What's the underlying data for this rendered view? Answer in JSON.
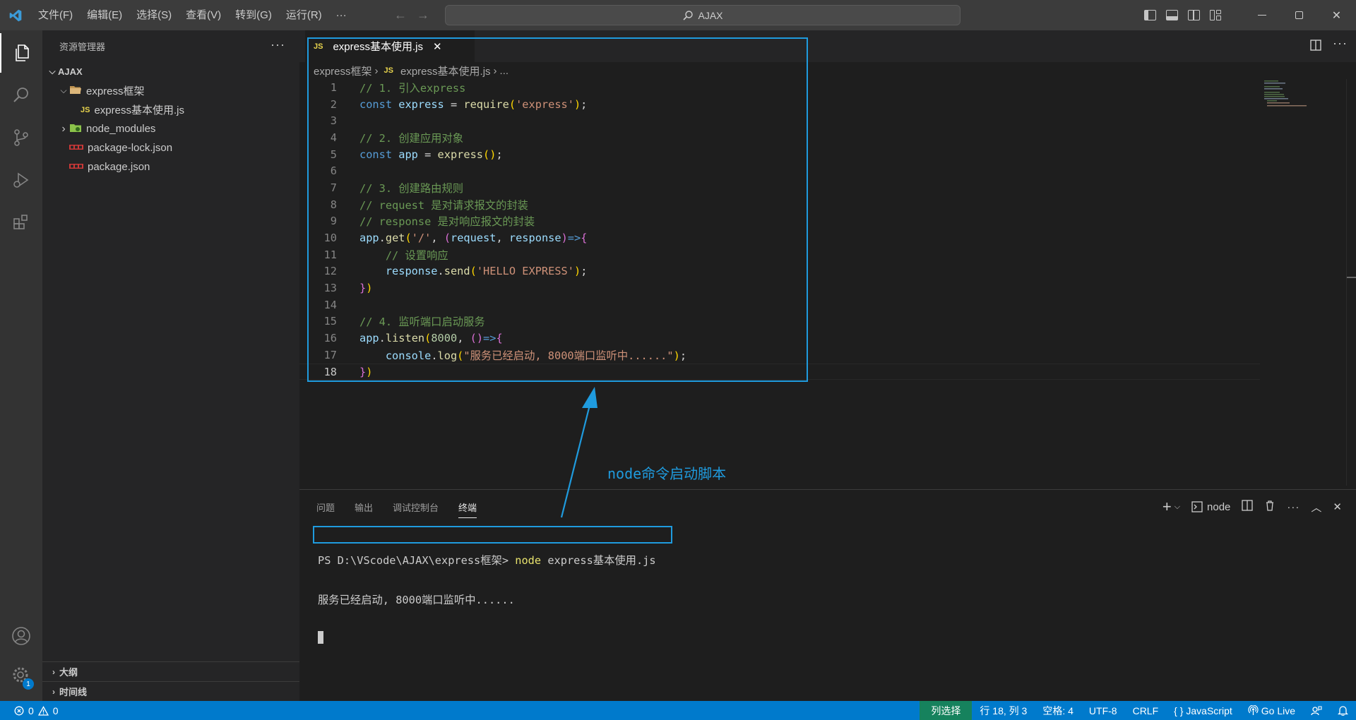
{
  "titlebar": {
    "menu": [
      "文件(F)",
      "编辑(E)",
      "选择(S)",
      "查看(V)",
      "转到(G)",
      "运行(R)",
      "···"
    ],
    "search": "AJAX"
  },
  "sidebar": {
    "title": "资源管理器",
    "root": "AJAX",
    "tree": [
      {
        "label": "express框架",
        "type": "folder-open",
        "depth": 1
      },
      {
        "label": "express基本使用.js",
        "type": "js",
        "depth": 2
      },
      {
        "label": "node_modules",
        "type": "folder-closed",
        "depth": 1
      },
      {
        "label": "package-lock.json",
        "type": "json",
        "depth": 1
      },
      {
        "label": "package.json",
        "type": "json",
        "depth": 1
      }
    ],
    "outline": "大纲",
    "timeline": "时间线"
  },
  "editor": {
    "tab": {
      "icon": "JS",
      "label": "express基本使用.js"
    },
    "breadcrumb": {
      "folder": "express框架",
      "file": "express基本使用.js",
      "more": "..."
    },
    "current_line": 18,
    "lines": [
      [
        [
          "// 1. 引入express",
          "comment"
        ]
      ],
      [
        [
          "const ",
          "kw"
        ],
        [
          "express",
          "var"
        ],
        [
          " = ",
          "p"
        ],
        [
          "require",
          "fn"
        ],
        [
          "(",
          "b1"
        ],
        [
          "'express'",
          "str"
        ],
        [
          ")",
          "b1"
        ],
        [
          ";",
          "p"
        ]
      ],
      [],
      [
        [
          "// 2. 创建应用对象",
          "comment"
        ]
      ],
      [
        [
          "const ",
          "kw"
        ],
        [
          "app",
          "var"
        ],
        [
          " = ",
          "p"
        ],
        [
          "express",
          "fn"
        ],
        [
          "()",
          "b1"
        ],
        [
          ";",
          "p"
        ]
      ],
      [],
      [
        [
          "// 3. 创建路由规则",
          "comment"
        ]
      ],
      [
        [
          "// request 是对请求报文的封装",
          "comment"
        ]
      ],
      [
        [
          "// response 是对响应报文的封装",
          "comment"
        ]
      ],
      [
        [
          "app",
          "var"
        ],
        [
          ".",
          "p"
        ],
        [
          "get",
          "fn"
        ],
        [
          "(",
          "b1"
        ],
        [
          "'/'",
          "str"
        ],
        [
          ", ",
          "p"
        ],
        [
          "(",
          "b2"
        ],
        [
          "request",
          "var"
        ],
        [
          ", ",
          "p"
        ],
        [
          "response",
          "var"
        ],
        [
          ")",
          "b2"
        ],
        [
          "=>",
          "kw"
        ],
        [
          "{",
          "b2"
        ]
      ],
      [
        [
          "    ",
          "p"
        ],
        [
          "// 设置响应",
          "comment"
        ]
      ],
      [
        [
          "    ",
          "p"
        ],
        [
          "response",
          "var"
        ],
        [
          ".",
          "p"
        ],
        [
          "send",
          "fn"
        ],
        [
          "(",
          "b1"
        ],
        [
          "'HELLO EXPRESS'",
          "str"
        ],
        [
          ")",
          "b1"
        ],
        [
          ";",
          "p"
        ]
      ],
      [
        [
          "}",
          "b2"
        ],
        [
          ")",
          "b1"
        ]
      ],
      [],
      [
        [
          "// 4. 监听端口启动服务",
          "comment"
        ]
      ],
      [
        [
          "app",
          "var"
        ],
        [
          ".",
          "p"
        ],
        [
          "listen",
          "fn"
        ],
        [
          "(",
          "b1"
        ],
        [
          "8000",
          "num"
        ],
        [
          ", ",
          "p"
        ],
        [
          "()",
          "b2"
        ],
        [
          "=>",
          "kw"
        ],
        [
          "{",
          "b2"
        ]
      ],
      [
        [
          "    ",
          "p"
        ],
        [
          "console",
          "var"
        ],
        [
          ".",
          "p"
        ],
        [
          "log",
          "fn"
        ],
        [
          "(",
          "b1"
        ],
        [
          "\"服务已经启动, 8000端口监听中......\"",
          "str"
        ],
        [
          ")",
          "b1"
        ],
        [
          ";",
          "p"
        ]
      ],
      [
        [
          "}",
          "b2"
        ],
        [
          ")",
          "b1"
        ]
      ]
    ]
  },
  "annotation": {
    "label": "node命令启动脚本",
    "color": "#1f9bde"
  },
  "panel": {
    "tabs": [
      "问题",
      "输出",
      "调试控制台",
      "终端"
    ],
    "active_tab": "终端",
    "shell_label": "node",
    "terminal": {
      "prompt": "PS D:\\VScode\\AJAX\\express框架> ",
      "command": "node",
      "args": " express基本使用.js",
      "output": "服务已经启动, 8000端口监听中......"
    }
  },
  "statusbar": {
    "errors": "0",
    "warnings": "0",
    "column_select": "列选择",
    "position": "行 18, 列 3",
    "spaces": "空格: 4",
    "encoding": "UTF-8",
    "eol": "CRLF",
    "language": "JavaScript",
    "golive": "Go Live",
    "notifications_badge": "1"
  }
}
